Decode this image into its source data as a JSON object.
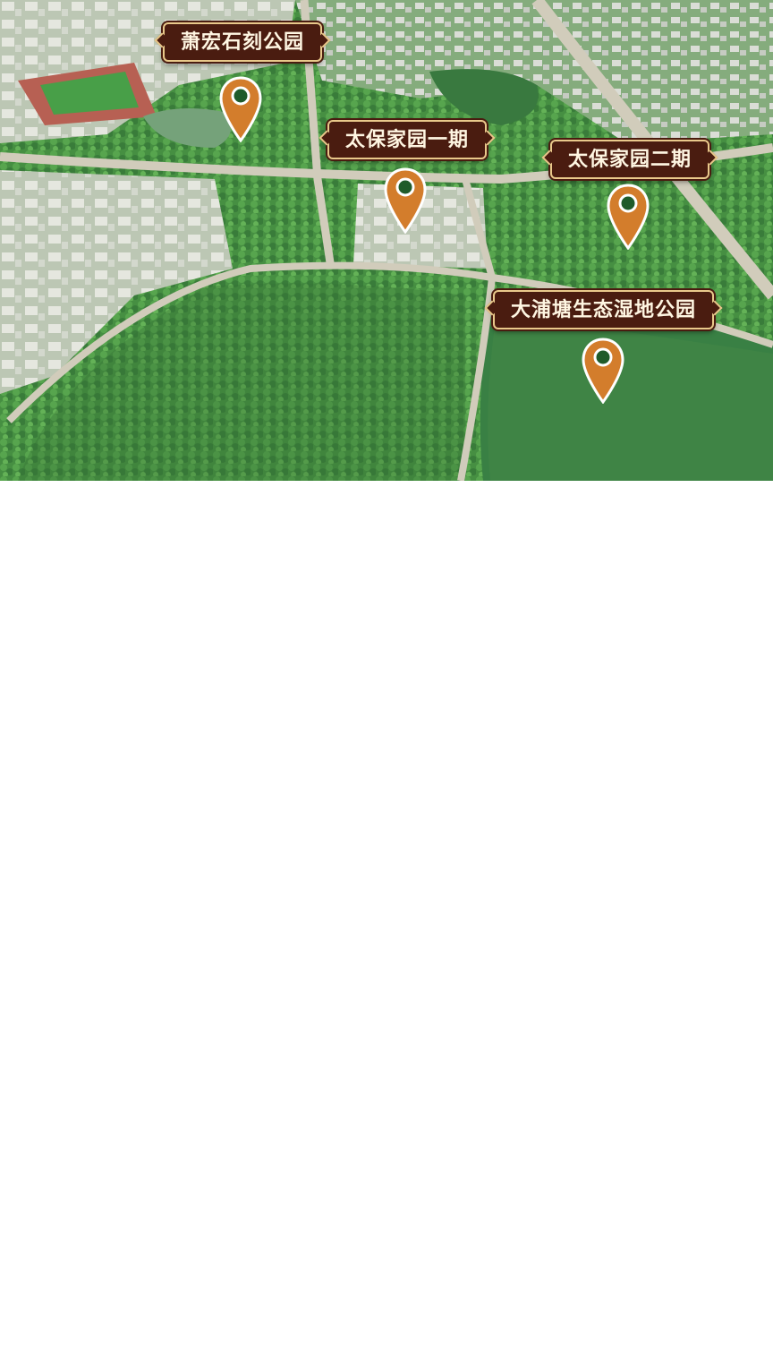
{
  "map": {
    "colors": {
      "forest": "#3f8a3a",
      "forest_dark": "#2b6a2a",
      "lake": "#2f7a3a",
      "road": "#cfcab8",
      "urban": "#c9d3c3",
      "label_bg": "#4a1c10",
      "label_border": "#e9c98b",
      "label_text": "#fff6e2",
      "pin_fill": "#d37d2c",
      "pin_center": "#1f5b2a"
    },
    "markers": [
      {
        "label": "萧宏石刻公园",
        "icon": "map-pin-icon"
      },
      {
        "label": "太保家园一期",
        "icon": "map-pin-icon"
      },
      {
        "label": "太保家园二期",
        "icon": "map-pin-icon"
      },
      {
        "label": "大浦塘生态湿地公园",
        "icon": "map-pin-icon"
      }
    ]
  }
}
